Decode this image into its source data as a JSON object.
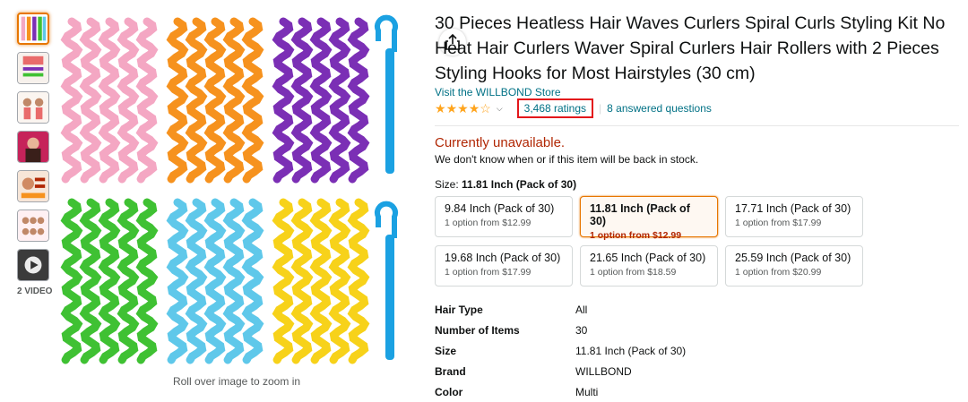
{
  "product": {
    "title": "30 Pieces Heatless Hair Waves Curlers Spiral Curls Styling Kit No Heat Hair Curlers Waver Spiral Curlers Hair Rollers with 2 Pieces Styling Hooks for Most Hairstyles (30 cm)",
    "store_link": "Visit the WILLBOND Store",
    "rating_stars": 4.5,
    "ratings_count": "3,468 ratings",
    "answered_questions": "8 answered questions",
    "availability": "Currently unavailable.",
    "availability_note": "We don't know when or if this item will be back in stock.",
    "size_label": "Size:",
    "size_selected": "11.81 Inch (Pack of 30)"
  },
  "gallery": {
    "video_label": "2 VIDEO",
    "zoom_hint": "Roll over image to zoom in",
    "curler_colors": [
      "#f4a7c3",
      "#f6921e",
      "#7b2fb5",
      "#3fc133",
      "#5fc8ea",
      "#f7d21a"
    ],
    "hook_color": "#1ba1e2"
  },
  "sizes": [
    {
      "name": "9.84 Inch (Pack of 30)",
      "price": "1 option from $12.99",
      "selected": false
    },
    {
      "name": "11.81 Inch (Pack of 30)",
      "price": "1 option from $12.99",
      "selected": true
    },
    {
      "name": "17.71 Inch (Pack of 30)",
      "price": "1 option from $17.99",
      "selected": false
    },
    {
      "name": "19.68 Inch (Pack of 30)",
      "price": "1 option from $17.99",
      "selected": false
    },
    {
      "name": "21.65 Inch (Pack of 30)",
      "price": "1 option from $18.59",
      "selected": false
    },
    {
      "name": "25.59 Inch (Pack of 30)",
      "price": "1 option from $20.99",
      "selected": false
    }
  ],
  "specs": [
    {
      "key": "Hair Type",
      "value": "All"
    },
    {
      "key": "Number of Items",
      "value": "30"
    },
    {
      "key": "Size",
      "value": "11.81 Inch (Pack of 30)"
    },
    {
      "key": "Brand",
      "value": "WILLBOND"
    },
    {
      "key": "Color",
      "value": "Multi"
    }
  ],
  "colors": {
    "link": "#007185",
    "star": "#ffa41c",
    "unavailable": "#b12704",
    "selected_border": "#e77600",
    "highlight_box": "#e3171b"
  }
}
